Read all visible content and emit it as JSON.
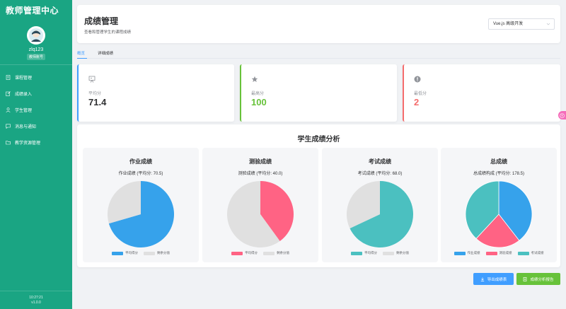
{
  "app": {
    "brand": "教师管理中心"
  },
  "user": {
    "name": "zlq123",
    "role": "教师账号"
  },
  "sidebar": {
    "items": [
      {
        "label": "课程管理",
        "icon": "document-icon"
      },
      {
        "label": "成绩录入",
        "icon": "edit-icon"
      },
      {
        "label": "学生管理",
        "icon": "user-icon"
      },
      {
        "label": "消息与通知",
        "icon": "chat-icon"
      },
      {
        "label": "教学资源管理",
        "icon": "folder-icon"
      }
    ],
    "footer_time": "10:27:21",
    "footer_version": "v1.0.0"
  },
  "header": {
    "title": "成绩管理",
    "subtitle": "查看和管理学生的课程成绩",
    "course_select": {
      "value": "Vue.js 高级开发"
    }
  },
  "tabs": [
    {
      "label": "概览",
      "active": true
    },
    {
      "label": "详细成绩",
      "active": false
    }
  ],
  "stats": [
    {
      "label": "平均分",
      "value": "71.4",
      "color": "#409eff",
      "value_color": "#303133",
      "icon": "presentation-icon"
    },
    {
      "label": "最高分",
      "value": "100",
      "color": "#67c23a",
      "value_color": "#67c23a",
      "icon": "star-icon"
    },
    {
      "label": "最低分",
      "value": "2",
      "color": "#f56c6c",
      "value_color": "#f56c6c",
      "icon": "alert-circle-icon"
    }
  ],
  "analysis": {
    "title": "学生成绩分析"
  },
  "chart_data": [
    {
      "type": "pie",
      "title": "作业成绩",
      "subtitle": "作业成绩 (平均分: 70.5)",
      "labels": [
        "平均得分",
        "剩余分值"
      ],
      "values": [
        70.5,
        29.5
      ],
      "colors": [
        "#36a2eb",
        "#e0e0e0"
      ]
    },
    {
      "type": "pie",
      "title": "测验成绩",
      "subtitle": "测验成绩 (平均分: 40.0)",
      "labels": [
        "平均得分",
        "剩余分值"
      ],
      "values": [
        40.0,
        60.0
      ],
      "colors": [
        "#ff6384",
        "#e0e0e0"
      ]
    },
    {
      "type": "pie",
      "title": "考试成绩",
      "subtitle": "考试成绩 (平均分: 68.0)",
      "labels": [
        "平均得分",
        "剩余分值"
      ],
      "values": [
        68.0,
        32.0
      ],
      "colors": [
        "#4bc0c0",
        "#e0e0e0"
      ]
    },
    {
      "type": "pie",
      "title": "总成绩",
      "subtitle": "总成绩构成 (平均分: 178.5)",
      "labels": [
        "作业成绩",
        "测验成绩",
        "考试成绩"
      ],
      "values": [
        70.5,
        40.0,
        68.0
      ],
      "colors": [
        "#36a2eb",
        "#ff6384",
        "#4bc0c0"
      ]
    }
  ],
  "actions": {
    "export_label": "导出成绩表",
    "report_label": "成绩分析报告",
    "export_color": "#409eff",
    "report_color": "#67c23a"
  }
}
